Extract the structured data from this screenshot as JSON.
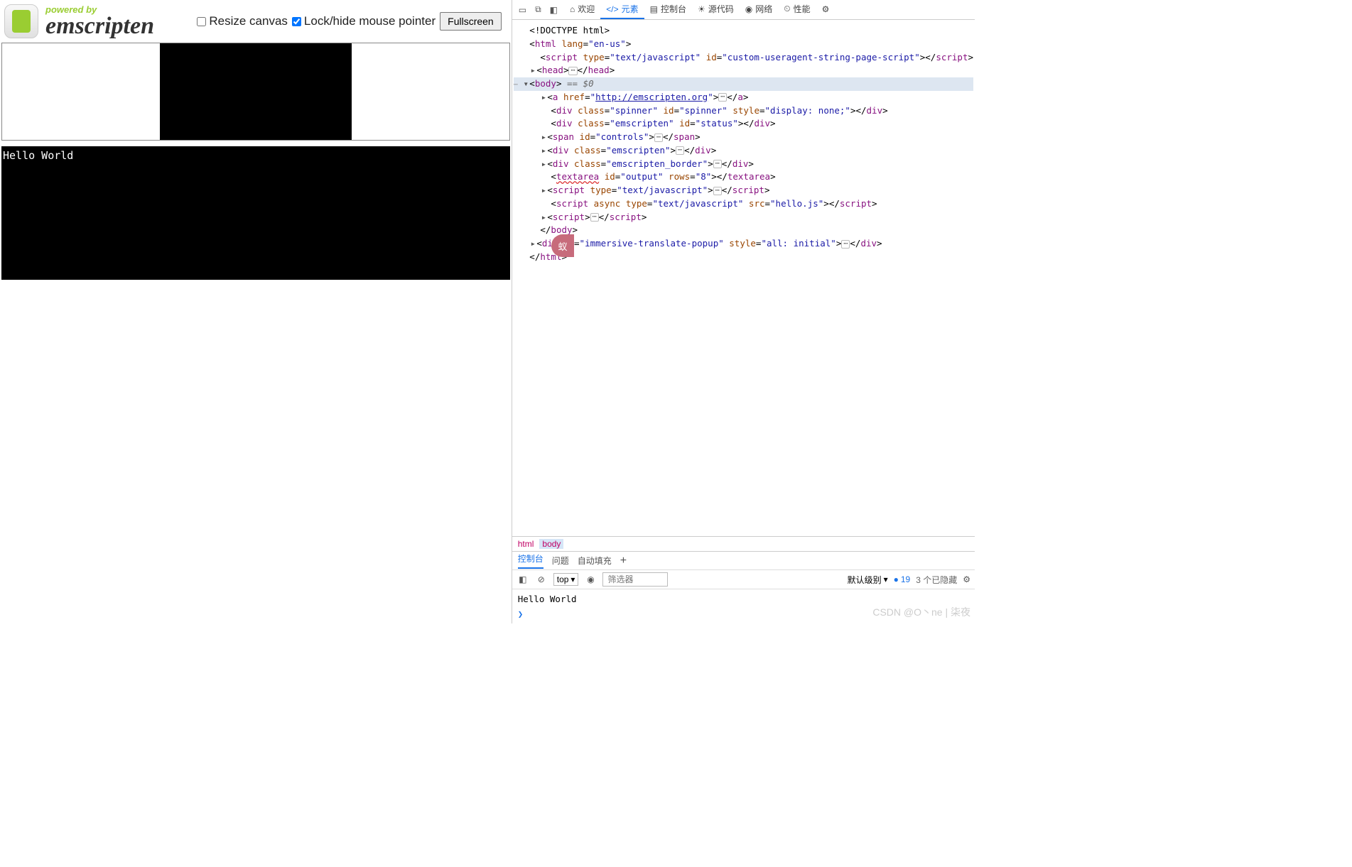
{
  "header": {
    "powered_by": "powered by",
    "brand": "emscripten",
    "resize_label": "Resize canvas",
    "lock_label": "Lock/hide mouse pointer",
    "fullscreen_label": "Fullscreen",
    "resize_checked": false,
    "lock_checked": true
  },
  "output": {
    "text": "Hello World"
  },
  "badge": {
    "text": "蚁"
  },
  "devtools": {
    "tabs": {
      "welcome": "欢迎",
      "elements": "元素",
      "console": "控制台",
      "sources": "源代码",
      "network": "网络",
      "performance": "性能"
    },
    "breadcrumb": {
      "html": "html",
      "body": "body"
    },
    "dom": {
      "doctype": "<!DOCTYPE html>",
      "html_open": "<html lang=\"en-us\">",
      "script1_open": "<script type=\"text/javascript\" id=\"custom-useragent-string-page-script\">",
      "script1_close": "</script>",
      "head_open": "<head>",
      "head_close": "</head>",
      "body_open": "<body>",
      "body_sel": " == $0",
      "a_open": "<a href=\"",
      "a_href": "http://emscripten.org",
      "a_mid": "\">",
      "a_close": "</a>",
      "spinner": "<div class=\"spinner\" id=\"spinner\" style=\"display: none;\"></div>",
      "status": "<div class=\"emscripten\" id=\"status\"></div>",
      "controls_open": "<span id=\"controls\">",
      "controls_close": "</span>",
      "emscripten_div_open": "<div class=\"emscripten\">",
      "div_close": "</div>",
      "border_open": "<div class=\"emscripten_border\">",
      "textarea": "<textarea id=\"output\" rows=\"8\"></textarea>",
      "textarea_tag": "textarea",
      "script_inline_open": "<script type=\"text/javascript\">",
      "script_close": "</script>",
      "script_async": "<script async type=\"text/javascript\" src=\"hello.js\"></script>",
      "script_plain_open": "<script>",
      "body_close": "</body>",
      "immersive": "<div id=\"immersive-translate-popup\" style=\"all: initial\">",
      "html_close": "</html>"
    },
    "console_tabs": {
      "console": "控制台",
      "issues": "问题",
      "autofill": "自动填充"
    },
    "console_toolbar": {
      "context": "top",
      "filter_placeholder": "筛选器",
      "level": "默认级别",
      "count": "19",
      "hidden": "3 个已隐藏"
    },
    "console_output": "Hello World",
    "prompt": ">"
  },
  "watermark": "CSDN @O丶ne | 柒夜"
}
